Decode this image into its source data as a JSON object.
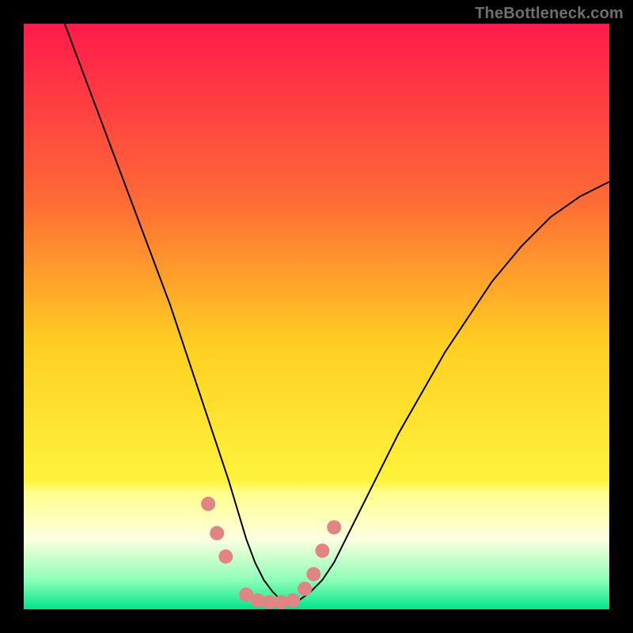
{
  "watermark": {
    "text": "TheBottleneck.com"
  },
  "chart_data": {
    "type": "line",
    "title": "",
    "xlabel": "",
    "ylabel": "",
    "xlim": [
      0,
      100
    ],
    "ylim": [
      0,
      100
    ],
    "grid": false,
    "legend": false,
    "background_gradient": {
      "stops": [
        {
          "offset": 0.0,
          "color": "#ff1a4b"
        },
        {
          "offset": 0.3,
          "color": "#ff6a36"
        },
        {
          "offset": 0.55,
          "color": "#ffd021"
        },
        {
          "offset": 0.78,
          "color": "#fff33a"
        },
        {
          "offset": 0.8,
          "color": "#ffff8a"
        },
        {
          "offset": 0.88,
          "color": "#fdffe0"
        },
        {
          "offset": 0.95,
          "color": "#8dffb8"
        },
        {
          "offset": 1.0,
          "color": "#00e48a"
        }
      ]
    },
    "series": [
      {
        "name": "curve",
        "kind": "line",
        "stroke": "#000000",
        "stroke_width": 2,
        "x": [
          7,
          10,
          13,
          16,
          19,
          22,
          25,
          27,
          29,
          31,
          33,
          35,
          36.5,
          38,
          39.5,
          41,
          42.5,
          44,
          45,
          46,
          47,
          49,
          51,
          53,
          55,
          57,
          60,
          64,
          68,
          72,
          76,
          80,
          85,
          90,
          95,
          100
        ],
        "y": [
          100,
          92,
          84,
          76,
          68,
          60,
          52,
          46,
          40,
          34,
          28,
          22,
          17,
          12,
          8,
          5,
          3,
          1.5,
          1,
          1,
          1.5,
          3,
          5,
          8,
          12,
          16,
          22,
          30,
          37,
          44,
          50,
          56,
          62,
          67,
          70.5,
          73
        ]
      },
      {
        "name": "markers",
        "kind": "scatter",
        "marker_color": "#e38484",
        "marker_size": 9,
        "x": [
          31.5,
          33.0,
          34.5,
          38.0,
          40.0,
          42.0,
          44.0,
          46.0,
          48.0,
          49.5,
          51.0,
          53.0
        ],
        "y": [
          18.0,
          13.0,
          9.0,
          2.5,
          1.5,
          1.2,
          1.2,
          1.5,
          3.5,
          6.0,
          10.0,
          14.0
        ]
      }
    ]
  }
}
